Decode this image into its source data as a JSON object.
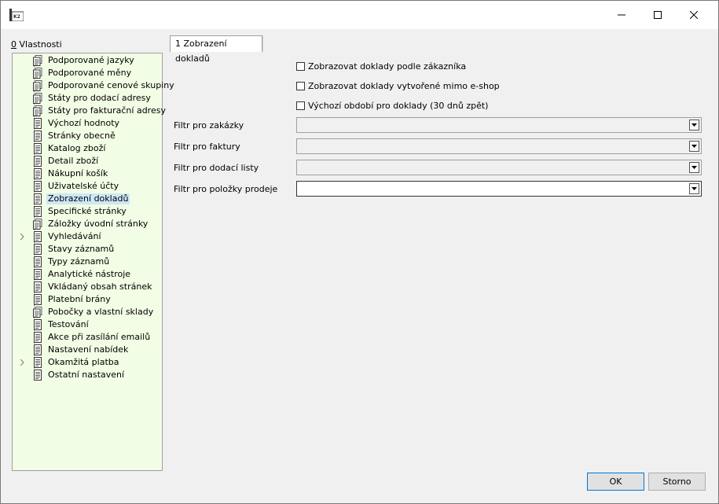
{
  "window": {
    "app_icon": "k2-app-icon"
  },
  "left_panel": {
    "header_key": "0",
    "header_text": " Vlastnosti",
    "items": [
      {
        "label": "Podporované jazyky",
        "icon": "doc-multi-icon",
        "expandable": false
      },
      {
        "label": "Podporované měny",
        "icon": "doc-multi-icon",
        "expandable": false
      },
      {
        "label": "Podporované cenové skupiny",
        "icon": "doc-multi-icon",
        "expandable": false
      },
      {
        "label": "Státy pro dodací adresy",
        "icon": "doc-multi-icon",
        "expandable": false
      },
      {
        "label": "Státy pro fakturační adresy",
        "icon": "doc-multi-icon",
        "expandable": false
      },
      {
        "label": "Výchozí hodnoty",
        "icon": "doc-icon",
        "expandable": false
      },
      {
        "label": "Stránky obecně",
        "icon": "doc-icon",
        "expandable": false
      },
      {
        "label": "Katalog zboží",
        "icon": "doc-icon",
        "expandable": false
      },
      {
        "label": "Detail zboží",
        "icon": "doc-icon",
        "expandable": false
      },
      {
        "label": "Nákupní košík",
        "icon": "doc-icon",
        "expandable": false
      },
      {
        "label": "Uživatelské účty",
        "icon": "doc-icon",
        "expandable": false
      },
      {
        "label": "Zobrazení dokladů",
        "icon": "doc-icon",
        "expandable": false,
        "selected": true
      },
      {
        "label": "Specifické stránky",
        "icon": "doc-icon",
        "expandable": false
      },
      {
        "label": "Záložky úvodní stránky",
        "icon": "doc-multi-icon",
        "expandable": false
      },
      {
        "label": "Vyhledávání",
        "icon": "doc-icon",
        "expandable": true
      },
      {
        "label": "Stavy záznamů",
        "icon": "doc-icon",
        "expandable": false
      },
      {
        "label": "Typy záznamů",
        "icon": "doc-icon",
        "expandable": false
      },
      {
        "label": "Analytické nástroje",
        "icon": "doc-icon",
        "expandable": false
      },
      {
        "label": "Vkládaný obsah stránek",
        "icon": "doc-icon",
        "expandable": false
      },
      {
        "label": "Platební brány",
        "icon": "doc-icon",
        "expandable": false
      },
      {
        "label": "Pobočky a vlastní sklady",
        "icon": "doc-multi-icon",
        "expandable": false
      },
      {
        "label": "Testování",
        "icon": "doc-icon",
        "expandable": false
      },
      {
        "label": "Akce při zasílání emailů",
        "icon": "doc-icon",
        "expandable": false
      },
      {
        "label": "Nastavení nabídek",
        "icon": "doc-icon",
        "expandable": false
      },
      {
        "label": "Okamžitá platba",
        "icon": "doc-icon",
        "expandable": true
      },
      {
        "label": "Ostatní nastavení",
        "icon": "doc-icon",
        "expandable": false
      }
    ]
  },
  "tab": {
    "label": "1 Zobrazení dokladů"
  },
  "checkboxes": [
    {
      "label": "Zobrazovat doklady podle zákazníka",
      "checked": false
    },
    {
      "label": "Zobrazovat doklady vytvořené mimo e-shop",
      "checked": false
    },
    {
      "label": "Výchozí období pro doklady (30 dnů zpět)",
      "checked": false
    }
  ],
  "filters": [
    {
      "label": "Filtr pro zakázky",
      "value": ""
    },
    {
      "label": "Filtr pro faktury",
      "value": ""
    },
    {
      "label": "Filtr pro dodací listy",
      "value": ""
    },
    {
      "label": "Filtr pro položky prodeje",
      "value": ""
    }
  ],
  "buttons": {
    "ok": "OK",
    "cancel": "Storno"
  }
}
